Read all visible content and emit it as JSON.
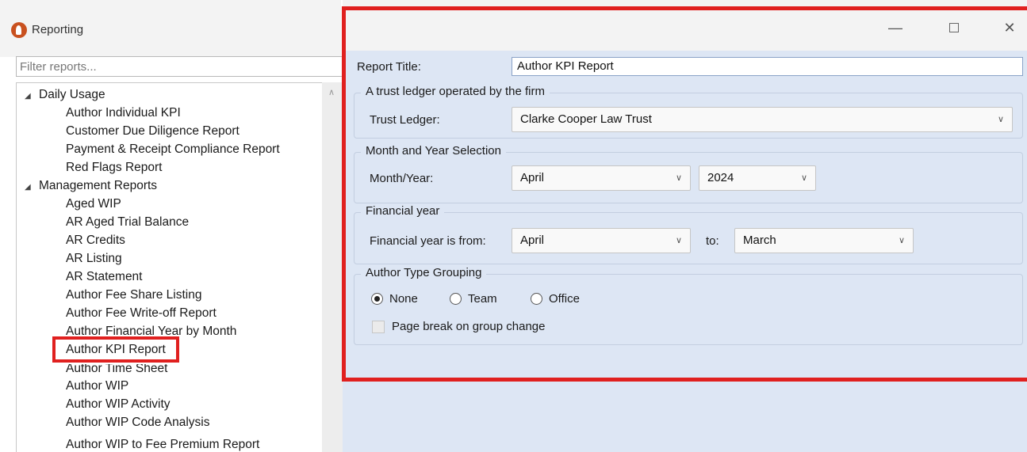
{
  "app": {
    "title": "Reporting"
  },
  "filter": {
    "placeholder": "Filter reports..."
  },
  "tree": {
    "groups": [
      {
        "label": "Daily Usage"
      },
      {
        "label": "Management Reports"
      }
    ],
    "daily_usage_items": [
      "Author Individual KPI",
      "Customer Due Diligence Report",
      "Payment & Receipt Compliance Report",
      "Red Flags Report"
    ],
    "management_items": [
      "Aged WIP",
      "AR Aged Trial Balance",
      "AR Credits",
      "AR Listing",
      "AR Statement",
      "Author Fee Share Listing",
      "Author Fee Write-off Report",
      "Author Financial Year by Month",
      "Author KPI Report",
      "Author Time Sheet",
      "Author WIP",
      "Author WIP Activity",
      "Author WIP Code Analysis",
      "Author WIP to Fee Premium Report"
    ],
    "selected": "Author KPI Report"
  },
  "window": {
    "minimize": "—",
    "close": "✕"
  },
  "form": {
    "report_title_label": "Report Title:",
    "report_title_value": "Author KPI Report",
    "trust_group": "A trust ledger operated by the firm",
    "trust_ledger_label": "Trust Ledger:",
    "trust_ledger_value": "Clarke Cooper Law Trust",
    "month_year_group": "Month and Year Selection",
    "month_year_label": "Month/Year:",
    "month_value": "April",
    "year_value": "2024",
    "financial_group": "Financial year",
    "financial_from_label": "Financial year is from:",
    "financial_from_value": "April",
    "to_label": "to:",
    "financial_to_value": "March",
    "author_group": "Author Type Grouping",
    "radio_none": "None",
    "radio_team": "Team",
    "radio_office": "Office",
    "radio_selected": "None",
    "page_break_label": "Page break on group change",
    "page_break_checked": false
  },
  "colors": {
    "highlight": "#e0201f",
    "panel_bg": "#dde6f4",
    "app_icon": "#c9511f"
  }
}
